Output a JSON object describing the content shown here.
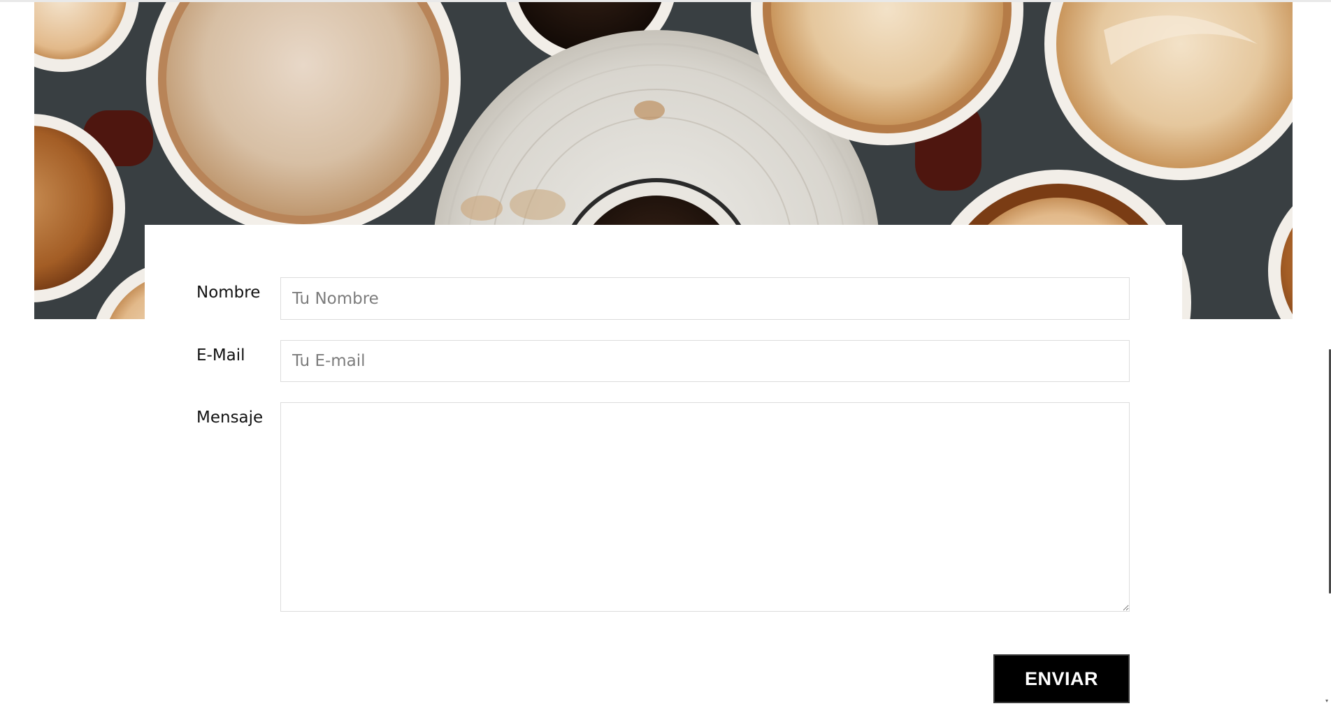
{
  "hero": {
    "image": "coffee-cups-top-view-photo",
    "colors": {
      "table": "#3e4448",
      "cup_rim": "#f2eee8",
      "latte": "#d9c4a8",
      "crema": "#a9652b",
      "espresso": "#1c120c",
      "mug_handle": "#5a1c12"
    }
  },
  "form": {
    "name": {
      "label": "Nombre",
      "placeholder": "Tu Nombre",
      "value": ""
    },
    "email": {
      "label": "E-Mail",
      "placeholder": "Tu E-mail",
      "value": ""
    },
    "message": {
      "label": "Mensaje",
      "value": ""
    },
    "submit_label": "ENVIAR"
  },
  "colors": {
    "button_bg": "#000000",
    "button_text": "#ffffff",
    "input_border": "#dcdcdc"
  }
}
